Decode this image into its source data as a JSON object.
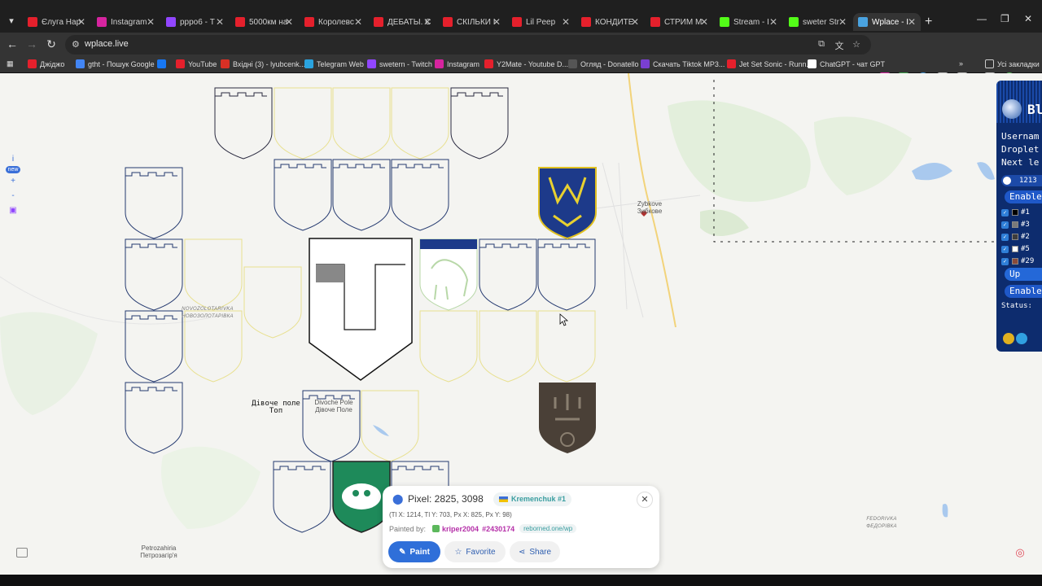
{
  "browser": {
    "tabs": [
      {
        "title": "Єлуга Нар",
        "color": "#e5202c"
      },
      {
        "title": "Instagram",
        "color": "#d6249f"
      },
      {
        "title": "pppo6 - Т",
        "color": "#9146ff"
      },
      {
        "title": "5000км на",
        "color": "#e5202c"
      },
      {
        "title": "Королевс",
        "color": "#e5202c"
      },
      {
        "title": "ДЕБАТЫ. С",
        "color": "#e5202c"
      },
      {
        "title": "СКІЛЬКИ І",
        "color": "#e5202c"
      },
      {
        "title": "Lil Peep",
        "color": "#e5202c"
      },
      {
        "title": "КОНДИТЕ",
        "color": "#e5202c"
      },
      {
        "title": "СТРИМ М",
        "color": "#e5202c"
      },
      {
        "title": "Stream - I",
        "color": "#53fc18"
      },
      {
        "title": "sweter Str",
        "color": "#53fc18"
      },
      {
        "title": "Wplace - I",
        "color": "#4aa3e0"
      }
    ],
    "active_tab_index": 12,
    "url": "wplace.live",
    "bookmarks": [
      {
        "label": "Джіджо",
        "color": "#e5202c"
      },
      {
        "label": "gtht - Пошук Google",
        "color": "#4285f4"
      },
      {
        "label": "",
        "color": "#1877f2"
      },
      {
        "label": "YouTube",
        "color": "#e5202c"
      },
      {
        "label": "Вхідні (3) - lyubcenk...",
        "color": "#d93025"
      },
      {
        "label": "Telegram Web",
        "color": "#2aa3df"
      },
      {
        "label": "swetern - Twitch",
        "color": "#9146ff"
      },
      {
        "label": "Instagram",
        "color": "#d6249f"
      },
      {
        "label": "Y2Mate - Youtube D...",
        "color": "#e5202c"
      },
      {
        "label": "Огляд - Donatello",
        "color": "#555555"
      },
      {
        "label": "Скачать Tiktok MP3...",
        "color": "#7a3fd0"
      },
      {
        "label": "Jet Set Sonic - Runn...",
        "color": "#e5202c"
      },
      {
        "label": "ChatGPT - чат GPT",
        "color": "#ffffff"
      }
    ],
    "all_bookmarks_label": "Усі закладки"
  },
  "map": {
    "labels": {
      "zybkove": "Zybkove\nЗибкове",
      "novozolotarivka": "NOVOZOLOTARIVKA\nНОВОЗОЛОТАРІВКА",
      "divoche": "Divoche Pole\nДівоче Поле",
      "petrozahiria": "Petrozahiria\nПетрозагір'я",
      "fedorivka": "FEDORIVKA\nФЕДОРІВКА",
      "handwritten": "Дівоче поле\nТоп"
    },
    "left_controls": {
      "info": "i",
      "new_badge": "new",
      "zoom_in": "+",
      "zoom_out": "-"
    }
  },
  "popup": {
    "title": "Pixel: 2825, 3098",
    "region": "Kremenchuk #1",
    "coords": "(Tl X: 1214, Tl Y: 703, Px X: 825, Px Y: 98)",
    "painted_by_label": "Painted by:",
    "user": "kriper2004",
    "user_id": "#2430174",
    "link": "reborned.one/wp",
    "buttons": {
      "paint": "Paint",
      "favorite": "Favorite",
      "share": "Share"
    },
    "close": "✕"
  },
  "panel": {
    "title": "Bl",
    "username": "Usernam",
    "droplets": "Droplet",
    "next": "Next le",
    "counter": "1213",
    "enable1": "Enable",
    "colors": [
      {
        "label": "#1",
        "swatch": "#000000"
      },
      {
        "label": "#3",
        "swatch": "#7a7a7a"
      },
      {
        "label": "#2",
        "swatch": "#3c3c3c"
      },
      {
        "label": "#5",
        "swatch": "#ffffff"
      },
      {
        "label": "#29",
        "swatch": "#8a4a3a"
      }
    ],
    "upload": "Up",
    "enable2": "Enable",
    "status": "Status:"
  }
}
